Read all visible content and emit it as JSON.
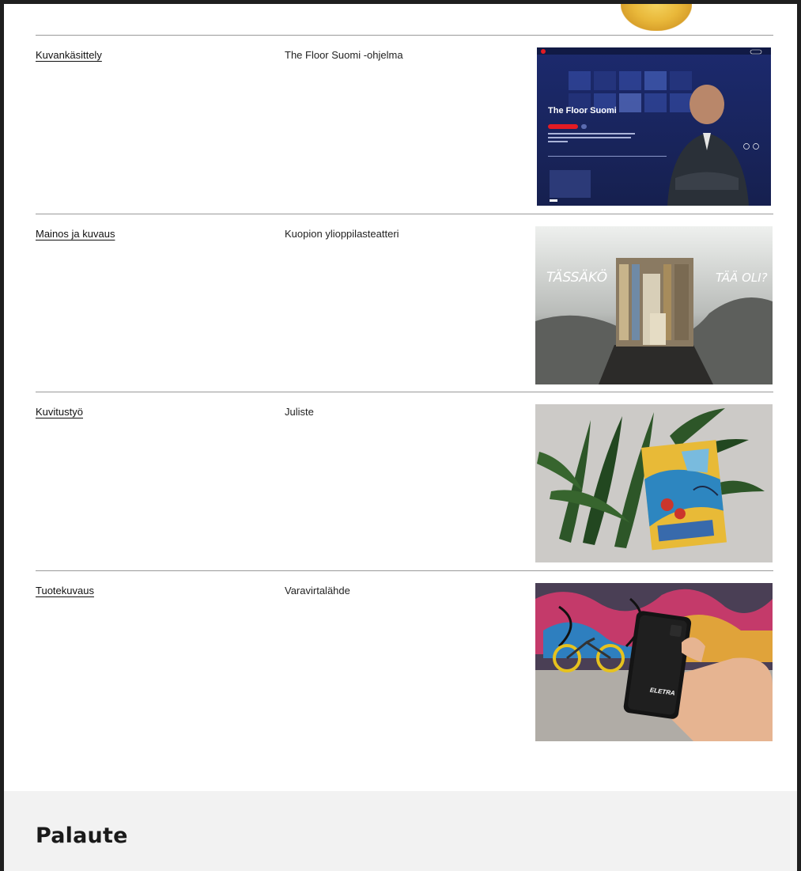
{
  "projects": [
    {
      "category": "Kuvankäsittely",
      "title": "The Floor Suomi -ohjelma",
      "thumb": {
        "heading": "The Floor Suomi"
      }
    },
    {
      "category": "Mainos ja kuvaus",
      "title": "Kuopion ylioppilasteatteri",
      "thumb": {
        "left_text": "TÄSSÄKÖ",
        "right_text": "TÄÄ OLI?"
      }
    },
    {
      "category": "Kuvitustyö",
      "title": "Juliste"
    },
    {
      "category": "Tuotekuvaus",
      "title": "Varavirtalähde",
      "thumb": {
        "brand": "ELETRA"
      }
    }
  ],
  "footer": {
    "heading": "Palaute"
  }
}
